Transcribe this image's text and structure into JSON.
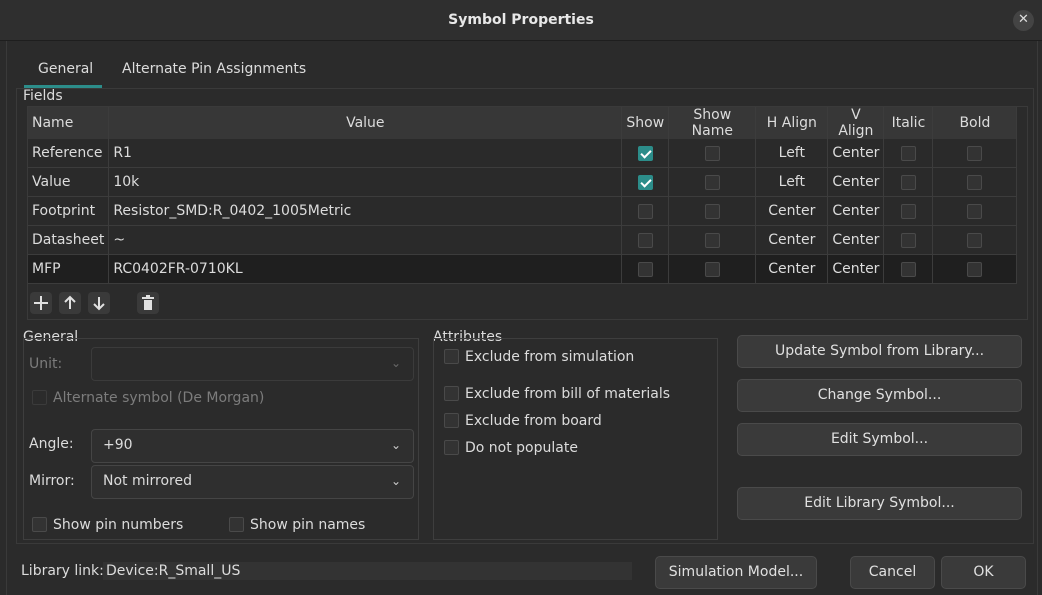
{
  "window": {
    "title": "Symbol Properties",
    "close_glyph": "✕"
  },
  "tabs": [
    {
      "label": "General",
      "active": true
    },
    {
      "label": "Alternate Pin Assignments",
      "active": false
    }
  ],
  "fields": {
    "section_label": "Fields",
    "columns": [
      "Name",
      "Value",
      "Show",
      "Show Name",
      "H Align",
      "V Align",
      "Italic",
      "Bold"
    ],
    "rows": [
      {
        "name": "Reference",
        "value": "R1",
        "show": true,
        "show_name": false,
        "h_align": "Left",
        "v_align": "Center",
        "italic": false,
        "bold": false
      },
      {
        "name": "Value",
        "value": "10k",
        "show": true,
        "show_name": false,
        "h_align": "Left",
        "v_align": "Center",
        "italic": false,
        "bold": false
      },
      {
        "name": "Footprint",
        "value": "Resistor_SMD:R_0402_1005Metric",
        "show": false,
        "show_name": false,
        "h_align": "Center",
        "v_align": "Center",
        "italic": false,
        "bold": false
      },
      {
        "name": "Datasheet",
        "value": "~",
        "show": false,
        "show_name": false,
        "h_align": "Center",
        "v_align": "Center",
        "italic": false,
        "bold": false
      },
      {
        "name": "MFP",
        "value": "RC0402FR-0710KL",
        "show": false,
        "show_name": false,
        "h_align": "Center",
        "v_align": "Center",
        "italic": false,
        "bold": false,
        "selected": true
      }
    ],
    "toolbar_icons": [
      "add-icon",
      "move-up-icon",
      "move-down-icon",
      "trash-icon"
    ]
  },
  "general": {
    "section_label": "General",
    "unit_label": "Unit:",
    "unit_value": "",
    "alternate_symbol_label": "Alternate symbol (De Morgan)",
    "angle_label": "Angle:",
    "angle_value": "+90",
    "mirror_label": "Mirror:",
    "mirror_value": "Not mirrored",
    "show_pin_numbers_label": "Show pin numbers",
    "show_pin_names_label": "Show pin names"
  },
  "attributes": {
    "section_label": "Attributes",
    "items": [
      {
        "label": "Exclude from simulation",
        "checked": false
      },
      {
        "label": "Exclude from bill of materials",
        "checked": false
      },
      {
        "label": "Exclude from board",
        "checked": false
      },
      {
        "label": "Do not populate",
        "checked": false
      }
    ]
  },
  "actions": {
    "update_symbol": "Update Symbol from Library...",
    "change_symbol": "Change Symbol...",
    "edit_symbol": "Edit Symbol...",
    "edit_library_symbol": "Edit Library Symbol..."
  },
  "footer": {
    "library_link_label": "Library link:",
    "library_link_value": "Device:R_Small_US",
    "simulation_model": "Simulation Model...",
    "cancel": "Cancel",
    "ok": "OK"
  },
  "colors": {
    "accent": "#2c8d8a",
    "background": "#2b2b2b"
  }
}
